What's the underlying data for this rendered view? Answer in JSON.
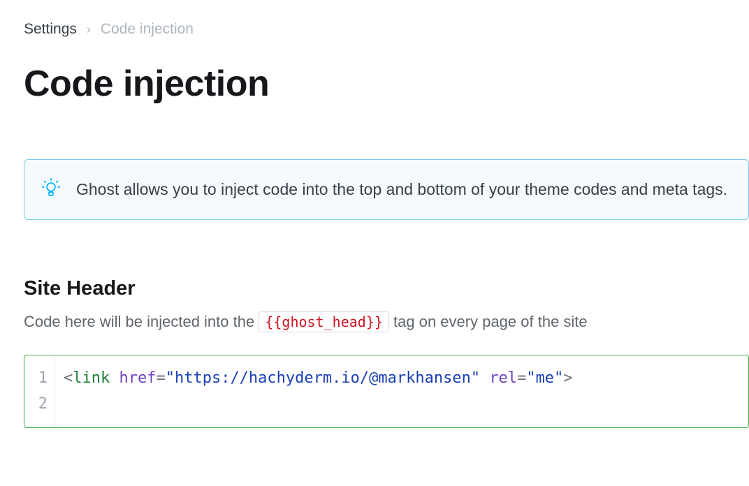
{
  "breadcrumb": {
    "root": "Settings",
    "separator": "›",
    "current": "Code injection"
  },
  "page_title": "Code injection",
  "info": {
    "icon": "lightbulb-icon",
    "text": "Ghost allows you to inject code into the top and bottom of your theme codes and meta tags."
  },
  "header_section": {
    "title": "Site Header",
    "desc_prefix": "Code here will be injected into the ",
    "chip": "{{ghost_head}}",
    "desc_suffix": " tag on every page of the site"
  },
  "editor": {
    "lines": [
      "1",
      "2"
    ],
    "code_tokens": {
      "open": "<",
      "tag": "link",
      "space1": " ",
      "attr1": "href",
      "eq": "=",
      "q": "\"",
      "val1": "https://hachyderm.io/@markhansen",
      "space2": " ",
      "attr2": "rel",
      "val2": "me",
      "close": ">"
    }
  }
}
